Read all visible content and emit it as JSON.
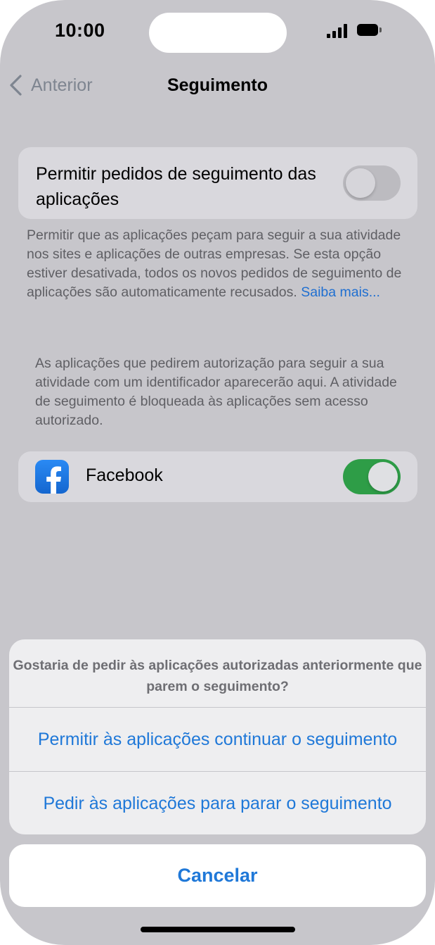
{
  "status_bar": {
    "time": "10:00"
  },
  "nav": {
    "back_label": "Anterior",
    "title": "Seguimento"
  },
  "tracking_request": {
    "label": "Permitir pedidos de seguimento das aplicações",
    "enabled": false
  },
  "description": {
    "text": "Permitir que as aplicações peçam para seguir a sua atividade nos sites e aplicações de outras empresas. Se esta opção estiver desativada, todos os novos pedidos de seguimento de aplicações são automaticamente recusados.",
    "link": "Saiba mais..."
  },
  "info_text": "As aplicações que pedirem autorização para seguir a sua atividade com um identificador aparecerão aqui. A atividade de seguimento é bloqueada às aplicações sem acesso autorizado.",
  "apps": [
    {
      "name": "Facebook",
      "icon": "facebook-icon",
      "enabled": true
    }
  ],
  "action_sheet": {
    "message": "Gostaria de pedir às aplicações autorizadas anteriormente que parem o seguimento?",
    "options": [
      "Permitir às aplicações continuar o seguimento",
      "Pedir às aplicações para parar o seguimento"
    ],
    "cancel": "Cancelar"
  },
  "colors": {
    "accent": "#1f78d8",
    "toggle_on": "#2e9d47",
    "dim_background": "#c7c6cb"
  }
}
